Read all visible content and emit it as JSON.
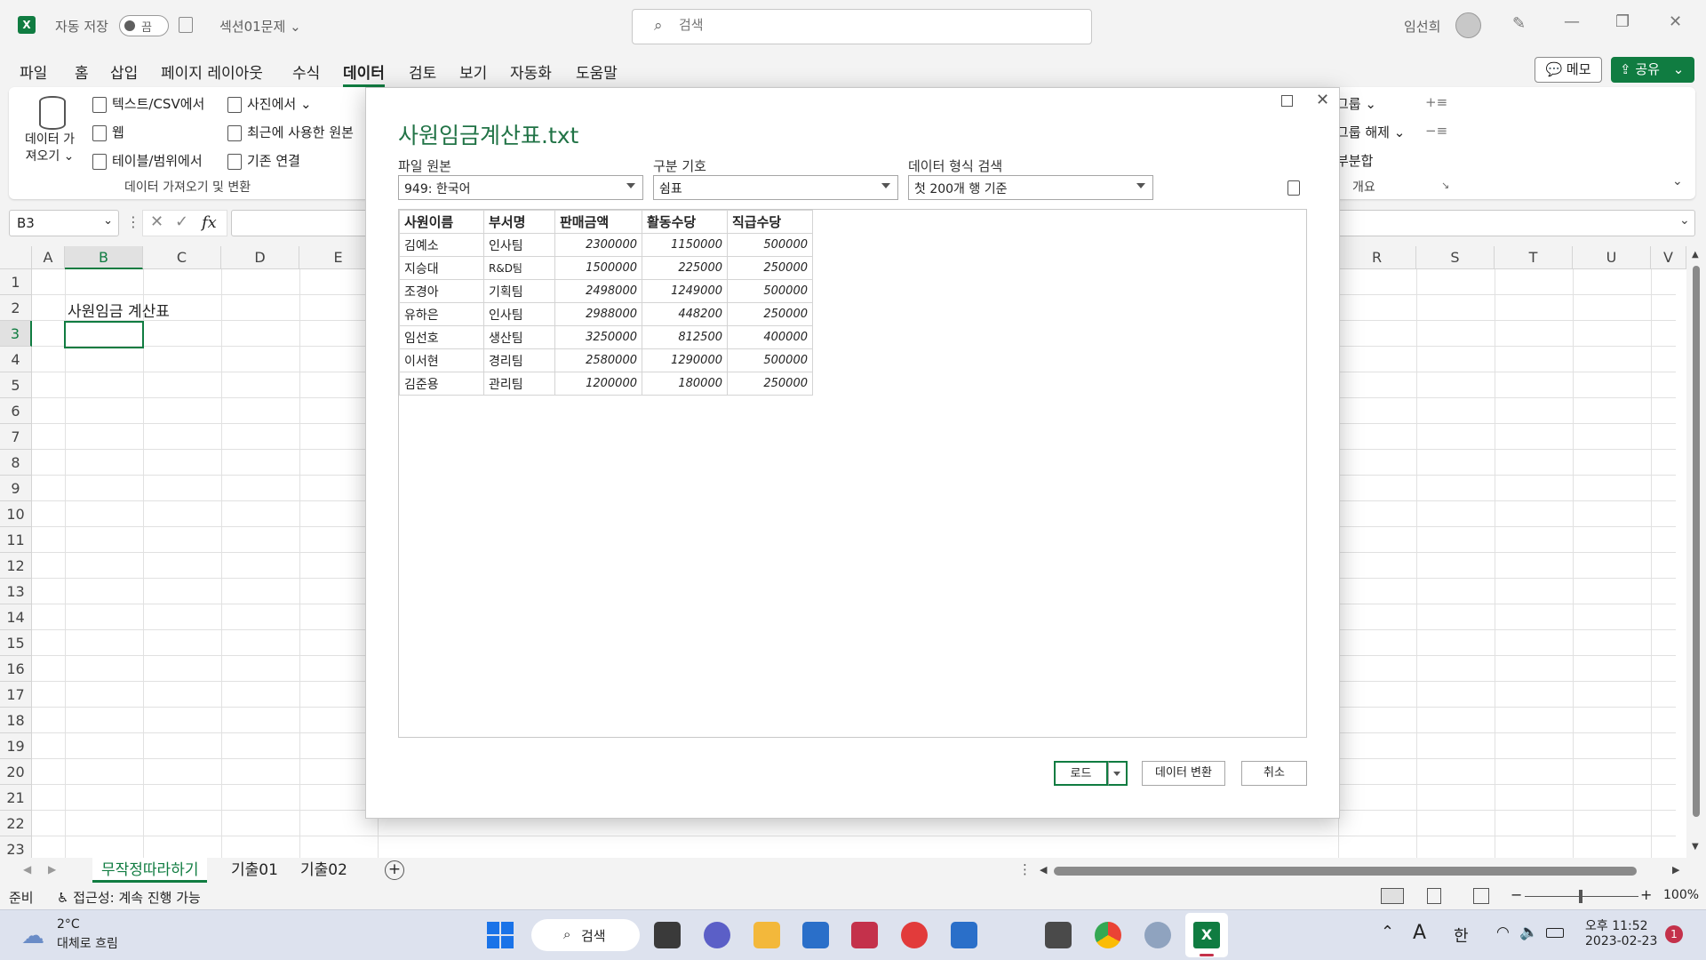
{
  "titlebar": {
    "autosave_label": "자동 저장",
    "autosave_state": "끔",
    "filename": "섹션01문제",
    "search_placeholder": "검색",
    "user": "임선희"
  },
  "menu": [
    "파일",
    "홈",
    "삽입",
    "페이지 레이아웃",
    "수식",
    "데이터",
    "검토",
    "보기",
    "자동화",
    "도움말"
  ],
  "menu_active": "데이터",
  "buttons": {
    "memo": "메모",
    "share": "공유"
  },
  "ribbon": {
    "get_data": "데이터 가\n져오기",
    "from_text_csv": "텍스트/CSV에서",
    "web": "웹",
    "from_table": "테이블/범위에서",
    "from_picture": "사진에서",
    "recent_sources": "최근에 사용한 원본",
    "existing_connections": "기존 연결",
    "group_get_transform": "데이터 가져오기 및 변환",
    "group_right_1": "그룹",
    "group_right_2": "그룹 해제",
    "group_right_3": "부분합",
    "group_outline": "개요"
  },
  "formula": {
    "namebox": "B3",
    "fx": "fx",
    "value": ""
  },
  "grid": {
    "columns": [
      "A",
      "B",
      "C",
      "D",
      "E",
      "R",
      "S",
      "T",
      "U",
      "V"
    ],
    "rows": [
      "1",
      "2",
      "3",
      "4",
      "5",
      "6",
      "7",
      "8",
      "9",
      "10",
      "11",
      "12",
      "13",
      "14",
      "15",
      "16",
      "17",
      "18",
      "19",
      "20",
      "21",
      "22",
      "23"
    ],
    "b2_value": "사원임금 계산표"
  },
  "sheets": [
    "무작정따라하기",
    "기출01",
    "기출02"
  ],
  "active_sheet": "무작정따라하기",
  "status": {
    "ready": "준비",
    "accessibility": "접근성: 계속 진행 가능",
    "zoom": "100%"
  },
  "taskbar": {
    "weather_temp": "2°C",
    "weather_desc": "대체로 흐림",
    "search": "검색",
    "time": "오후 11:52",
    "date": "2023-02-23",
    "ime_a": "A",
    "ime_han": "한",
    "badge": "1"
  },
  "dialog": {
    "title": "사원임금계산표.txt",
    "origin_label": "파일 원본",
    "origin_value": "949: 한국어",
    "delimiter_label": "구분 기호",
    "delimiter_value": "쉼표",
    "detect_label": "데이터 형식 검색",
    "detect_value": "첫 200개 행 기준",
    "headers": [
      "사원이름",
      "부서명",
      "판매금액",
      "활동수당",
      "직급수당"
    ],
    "rows": [
      [
        "김예소",
        "인사팀",
        "2300000",
        "1150000",
        "500000"
      ],
      [
        "지승대",
        "R&D팀",
        "1500000",
        "225000",
        "250000"
      ],
      [
        "조경아",
        "기획팀",
        "2498000",
        "1249000",
        "500000"
      ],
      [
        "유하은",
        "인사팀",
        "2988000",
        "448200",
        "250000"
      ],
      [
        "임선호",
        "생산팀",
        "3250000",
        "812500",
        "400000"
      ],
      [
        "이서현",
        "경리팀",
        "2580000",
        "1290000",
        "500000"
      ],
      [
        "김준용",
        "관리팀",
        "1200000",
        "180000",
        "250000"
      ]
    ],
    "load": "로드",
    "transform": "데이터 변환",
    "cancel": "취소"
  }
}
